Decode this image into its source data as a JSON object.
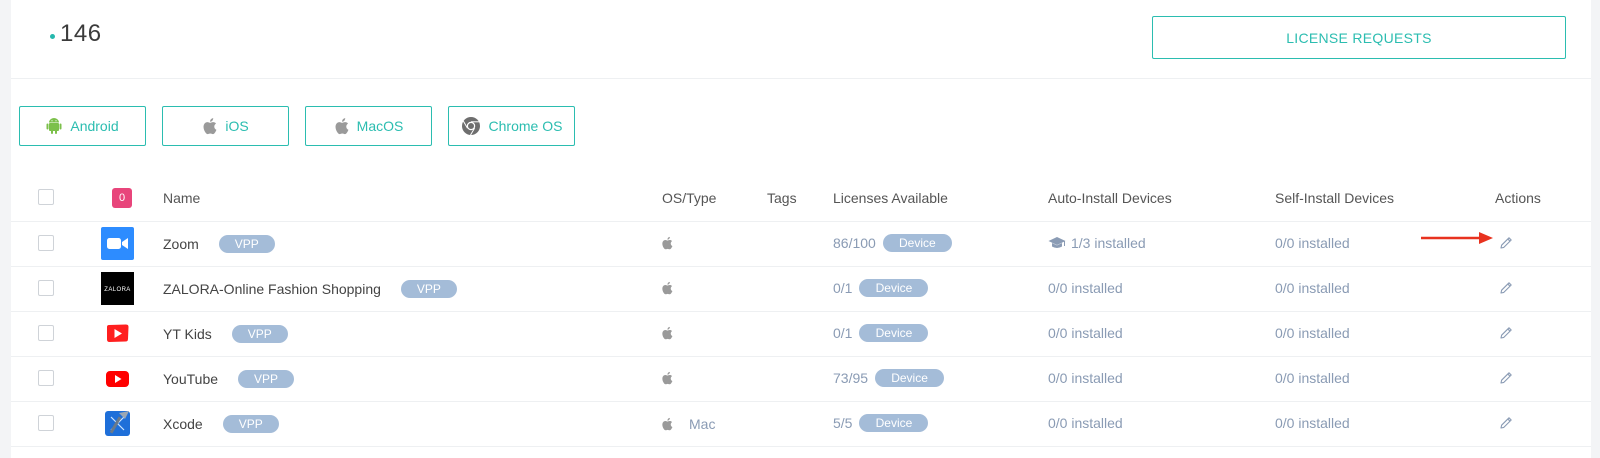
{
  "header": {
    "count": "146",
    "license_requests_label": "LICENSE REQUESTS"
  },
  "os_filters": [
    {
      "label": "Android",
      "icon": "android-icon"
    },
    {
      "label": "iOS",
      "icon": "apple-icon"
    },
    {
      "label": "MacOS",
      "icon": "apple-icon"
    },
    {
      "label": "Chrome OS",
      "icon": "chrome-icon"
    }
  ],
  "table": {
    "selected_count": "0",
    "columns": {
      "name": "Name",
      "os_type": "OS/Type",
      "tags": "Tags",
      "licenses": "Licenses Available",
      "auto_install": "Auto-Install Devices",
      "self_install": "Self-Install Devices",
      "actions": "Actions"
    },
    "rows": [
      {
        "name": "Zoom",
        "badge": "VPP",
        "os_label": "",
        "licenses": "86/100",
        "license_type": "Device",
        "auto": "1/3 installed",
        "self": "0/0 installed",
        "icon": "zoom-icon"
      },
      {
        "name": "ZALORA-Online Fashion Shopping",
        "badge": "VPP",
        "os_label": "",
        "licenses": "0/1",
        "license_type": "Device",
        "auto": "0/0 installed",
        "self": "0/0 installed",
        "icon": "zalora-icon",
        "icon_text": "ZALORA"
      },
      {
        "name": "YT Kids",
        "badge": "VPP",
        "os_label": "",
        "licenses": "0/1",
        "license_type": "Device",
        "auto": "0/0 installed",
        "self": "0/0 installed",
        "icon": "yt-kids-icon"
      },
      {
        "name": "YouTube",
        "badge": "VPP",
        "os_label": "",
        "licenses": "73/95",
        "license_type": "Device",
        "auto": "0/0 installed",
        "self": "0/0 installed",
        "icon": "youtube-icon"
      },
      {
        "name": "Xcode",
        "badge": "VPP",
        "os_label": "Mac",
        "licenses": "5/5",
        "license_type": "Device",
        "auto": "0/0 installed",
        "self": "0/0 installed",
        "icon": "xcode-icon"
      }
    ]
  },
  "colors": {
    "accent": "#2bbdb0",
    "badge": "#a4bcd8",
    "count_badge": "#e8457b",
    "arrow": "#e8321f"
  }
}
